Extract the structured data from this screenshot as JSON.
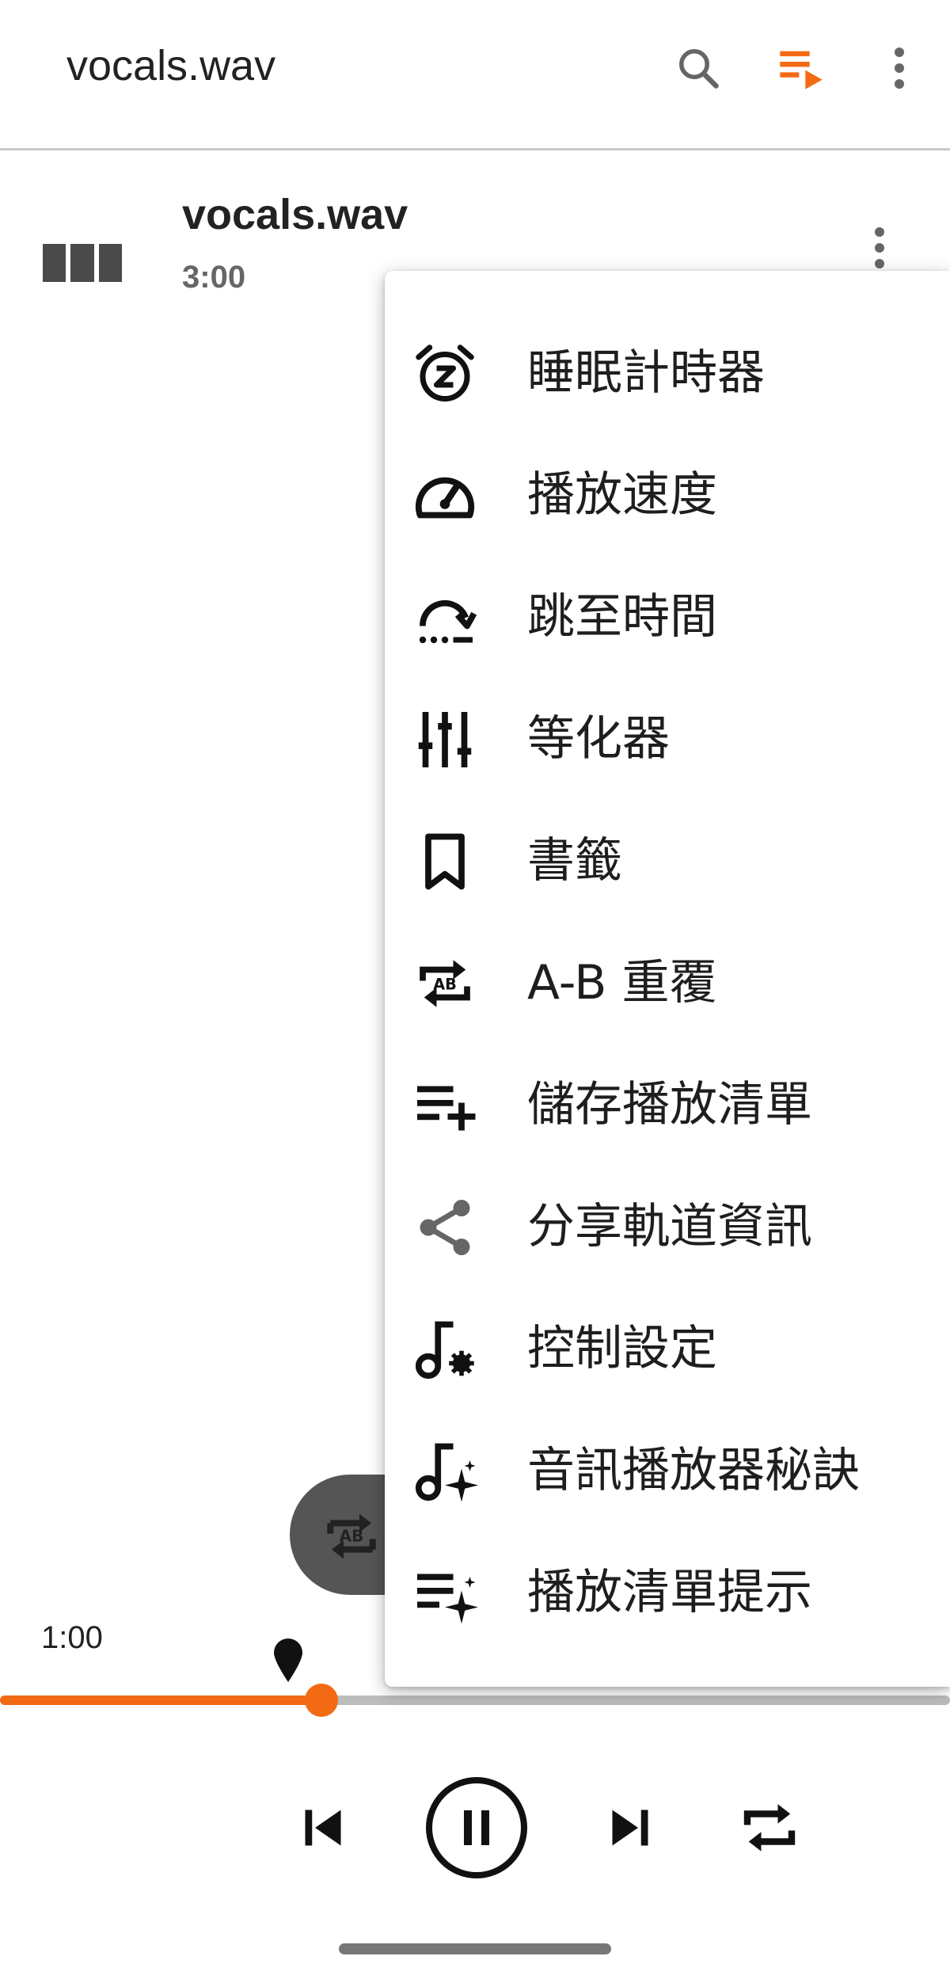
{
  "appbar": {
    "title": "vocals.wav",
    "accent": "#f26a13",
    "icons": [
      "search-icon",
      "queue-icon",
      "more-vert-icon"
    ]
  },
  "track": {
    "title": "vocals.wav",
    "duration": "3:00"
  },
  "menu": {
    "items": [
      {
        "label": "睡眠計時器",
        "icon": "sleep-timer-icon"
      },
      {
        "label": "播放速度",
        "icon": "speed-icon"
      },
      {
        "label": "跳至時間",
        "icon": "jump-to-time-icon"
      },
      {
        "label": "等化器",
        "icon": "equalizer-icon"
      },
      {
        "label": "書籤",
        "icon": "bookmark-icon"
      },
      {
        "label": "A-B 重覆",
        "icon": "ab-repeat-icon"
      },
      {
        "label": "儲存播放清單",
        "icon": "playlist-add-icon"
      },
      {
        "label": "分享軌道資訊",
        "icon": "share-icon"
      },
      {
        "label": "控制設定",
        "icon": "music-settings-icon"
      },
      {
        "label": "音訊播放器秘訣",
        "icon": "music-tips-icon"
      },
      {
        "label": "播放清單提示",
        "icon": "playlist-tips-icon"
      }
    ]
  },
  "player": {
    "current_time": "1:00",
    "progress": 0.338,
    "progress_color": "#f26a13",
    "controls": [
      "skip-previous-icon",
      "pause-icon",
      "skip-next-icon",
      "repeat-icon"
    ]
  }
}
